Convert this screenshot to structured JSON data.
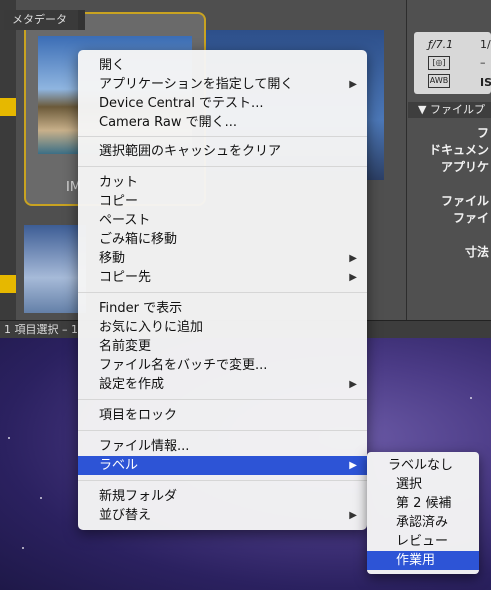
{
  "bridge": {
    "thumbnail_label": "IM",
    "panel_tab": "メタデータ",
    "metadata": {
      "aperture": "ƒ/7.1",
      "col2_top": "1/",
      "icon1": "[◎]",
      "icon2": "AWB",
      "col2_mid": "–",
      "iso": "ISO"
    },
    "file_section": "ファイルプ",
    "rows": [
      "フ",
      "ドキュメン",
      "アプリケ",
      "ファイル",
      "ファイ",
      "寸法"
    ],
    "status": "1 項目選択 – 1"
  },
  "context_menu": {
    "items": [
      {
        "label": "開く",
        "submenu": false
      },
      {
        "label": "アプリケーションを指定して開く",
        "submenu": true
      },
      {
        "label": "Device Central でテスト...",
        "submenu": false
      },
      {
        "label": "Camera Raw で開く...",
        "submenu": false
      },
      {
        "label": "選択範囲のキャッシュをクリア",
        "submenu": false
      },
      {
        "label": "カット",
        "submenu": false
      },
      {
        "label": "コピー",
        "submenu": false
      },
      {
        "label": "ペースト",
        "submenu": false
      },
      {
        "label": "ごみ箱に移動",
        "submenu": false
      },
      {
        "label": "移動",
        "submenu": true
      },
      {
        "label": "コピー先",
        "submenu": true
      },
      {
        "label": "Finder で表示",
        "submenu": false
      },
      {
        "label": "お気に入りに追加",
        "submenu": false
      },
      {
        "label": "名前変更",
        "submenu": false
      },
      {
        "label": "ファイル名をバッチで変更...",
        "submenu": false
      },
      {
        "label": "設定を作成",
        "submenu": true
      },
      {
        "label": "項目をロック",
        "submenu": false
      },
      {
        "label": "ファイル情報...",
        "submenu": false
      },
      {
        "label": "ラベル",
        "submenu": true,
        "selected": true
      },
      {
        "label": "新規フォルダ",
        "submenu": false
      },
      {
        "label": "並び替え",
        "submenu": true
      }
    ]
  },
  "label_submenu": {
    "items": [
      {
        "label": "ラベルなし"
      },
      {
        "label": "選択"
      },
      {
        "label": "第 2 候補"
      },
      {
        "label": "承認済み"
      },
      {
        "label": "レビュー"
      },
      {
        "label": "作業用",
        "selected": true
      }
    ]
  },
  "colors": {
    "accent": "#2d54d6",
    "label_tab": "#e6b800"
  }
}
